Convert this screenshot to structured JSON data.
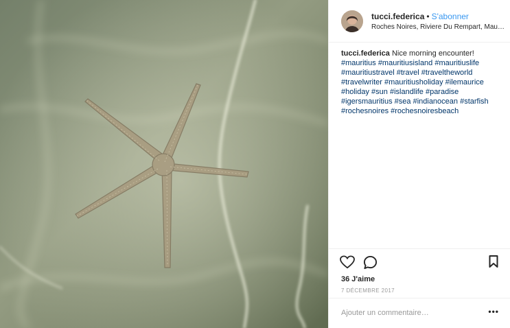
{
  "post": {
    "username": "tucci.federica",
    "follow_label": "S'abonner",
    "separator": "•",
    "location": "Roches Noires, Riviere Du Rempart, Maurit…",
    "caption_text": "Nice morning encounter!",
    "hashtags": [
      "#mauritius",
      "#mauritiusisland",
      "#mauritiuslife",
      "#mauritiustravel",
      "#travel",
      "#traveltheworld",
      "#travelwriter",
      "#mauritiusholiday",
      "#ilemaurice",
      "#holiday",
      "#sun",
      "#islandlife",
      "#paradise",
      "#igersmauritius",
      "#sea",
      "#indianocean",
      "#starfish",
      "#rochesnoires",
      "#rochesnoiresbeach"
    ],
    "likes_label": "36 J'aime",
    "date_label": "7 DÉCEMBRE 2017",
    "comment_placeholder": "Ajouter un commentaire…",
    "more_label": "•••"
  },
  "icons": {
    "like": "heart-icon",
    "comment": "comment-bubble-icon",
    "save": "bookmark-icon",
    "more": "ellipsis-icon"
  },
  "colors": {
    "link": "#3897f0",
    "hashtag": "#003569",
    "text": "#262626",
    "muted": "#999999",
    "border": "#efefef"
  }
}
